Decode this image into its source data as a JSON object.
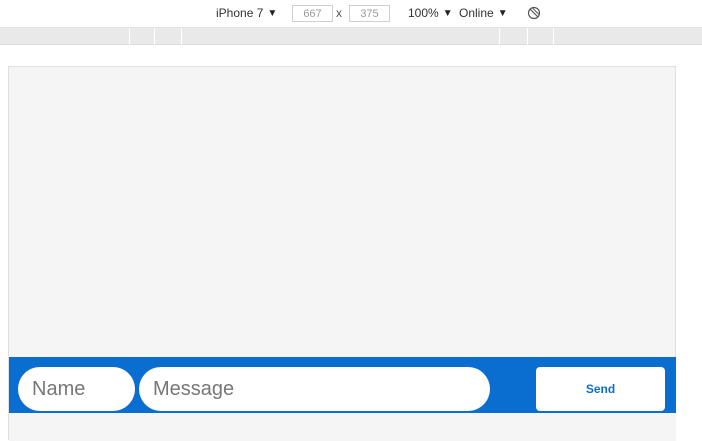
{
  "toolbar": {
    "device": "iPhone 7",
    "width": "667",
    "times": "x",
    "height": "375",
    "zoom": "100%",
    "network": "Online",
    "caret_icon": "▼",
    "rotate_icon": "rotate-icon"
  },
  "chat": {
    "name_placeholder": "Name",
    "message_placeholder": "Message",
    "send_label": "Send",
    "accent_color": "#0a6dd0"
  }
}
